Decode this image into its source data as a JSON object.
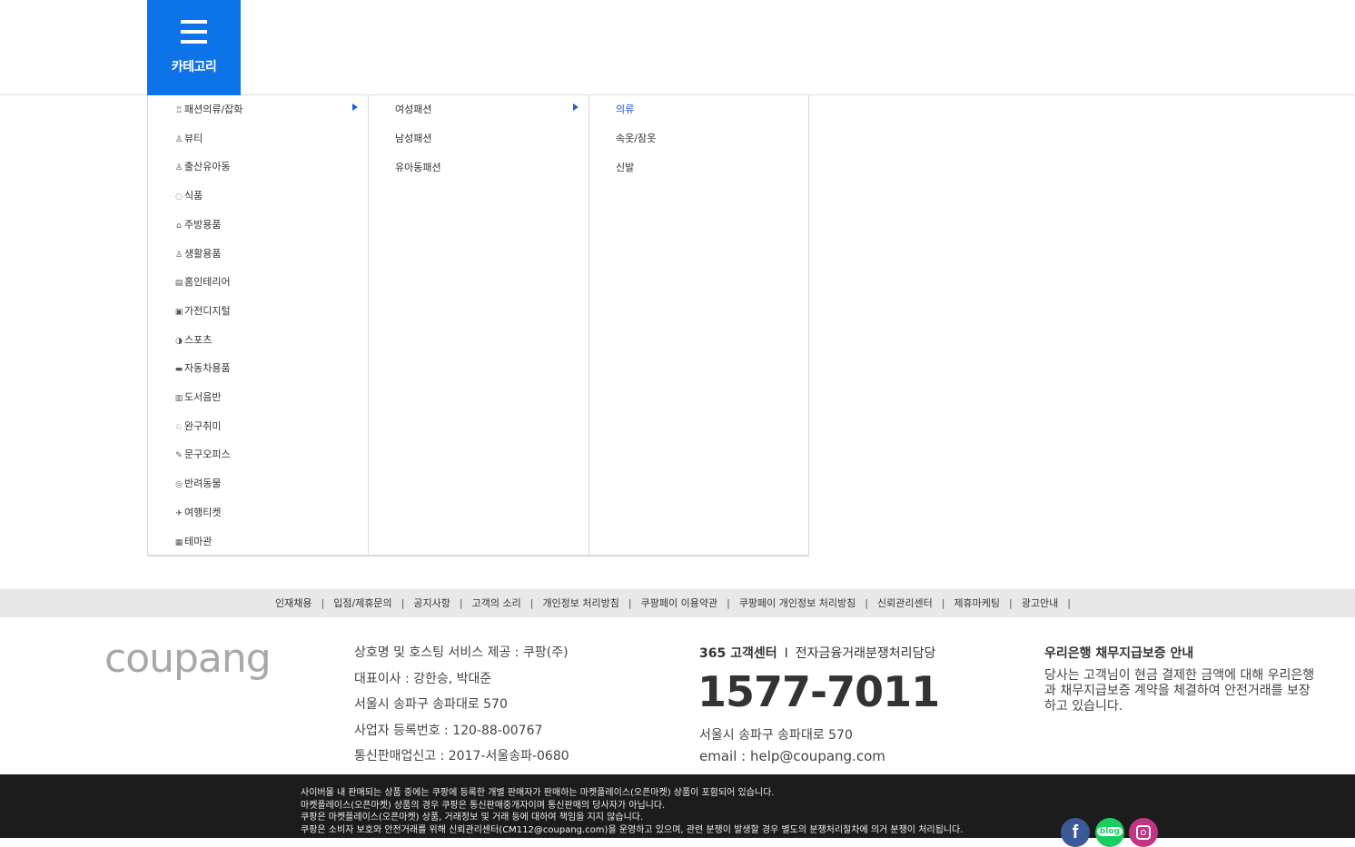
{
  "header": {
    "category_label": "카테고리",
    "accent_color": "#0d73e8"
  },
  "menu": {
    "level1": [
      {
        "label": "패션의류/잡화",
        "icon": "clothes-icon",
        "glyph": "♖"
      },
      {
        "label": "뷰티",
        "icon": "beauty-icon",
        "glyph": "♙"
      },
      {
        "label": "출산유아동",
        "icon": "baby-icon",
        "glyph": "♙"
      },
      {
        "label": "식품",
        "icon": "food-icon",
        "glyph": "◌"
      },
      {
        "label": "주방용품",
        "icon": "kitchen-icon",
        "glyph": "⌂"
      },
      {
        "label": "생활용품",
        "icon": "living-icon",
        "glyph": "♙"
      },
      {
        "label": "홈인테리어",
        "icon": "interior-icon",
        "glyph": "▤"
      },
      {
        "label": "가전디지털",
        "icon": "appliance-icon",
        "glyph": "▣"
      },
      {
        "label": "스포츠",
        "icon": "sports-icon",
        "glyph": "◑"
      },
      {
        "label": "자동차용품",
        "icon": "car-icon",
        "glyph": "▬"
      },
      {
        "label": "도서음반",
        "icon": "book-icon",
        "glyph": "▥"
      },
      {
        "label": "완구취미",
        "icon": "toy-icon",
        "glyph": "♘"
      },
      {
        "label": "문구오피스",
        "icon": "pen-icon",
        "glyph": "✎"
      },
      {
        "label": "반려동물",
        "icon": "pet-icon",
        "glyph": "◎"
      },
      {
        "label": "여행티켓",
        "icon": "travel-icon",
        "glyph": "✈"
      },
      {
        "label": "테마관",
        "icon": "theme-icon",
        "glyph": "▦"
      }
    ],
    "level2": [
      "여성패션",
      "남성패션",
      "유아동패션"
    ],
    "level3": [
      "의류",
      "속옷/잠옷",
      "신발"
    ]
  },
  "footer_links": [
    "인재채용",
    "입점/제휴문의",
    "공지사항",
    "고객의 소리",
    "개인정보 처리방침",
    "쿠팡페이 이용약관",
    "쿠팡페이 개인정보 처리방침",
    "신뢰관리센터",
    "제휴마케팅",
    "광고안내"
  ],
  "footer_sep": "|",
  "company": {
    "logo": "coupang",
    "lines": [
      "상호명 및 호스팅 서비스 제공 : 쿠팡(주)",
      "대표이사 : 강한승, 박대준",
      "서울시 송파구 송파대로 570",
      "사업자 등록번호 : 120-88-00767",
      "통신판매업신고 : 2017-서울송파-0680"
    ]
  },
  "customer_center": {
    "title": "365 고객센터",
    "bar": "I",
    "subtitle": "전자금융거래분쟁처리담당",
    "phone": "1577-7011",
    "address": "서울시 송파구 송파대로 570",
    "email": "email : help@coupang.com"
  },
  "bank": {
    "title": "우리은행 채무지급보증 안내",
    "desc": "당사는 고객님이 현금 결제한 금액에 대해 우리은행과 채무지급보증 계약을 체결하여 안전거래를 보장하고 있습니다."
  },
  "legal": [
    "사이버몰 내 판매되는 상품 중에는 쿠팡에 등록한 개별 판매자가 판매하는 마켓플레이스(오픈마켓) 상품이 포함되어 있습니다.",
    "마켓플레이스(오픈마켓) 상품의 경우 쿠팡은 통신판매중개자이며 통신판매의 당사자가 아닙니다.",
    "쿠팡은 마켓플레이스(오픈마켓) 상품, 거래정보 및 거래 등에 대하여 책임을 지지 않습니다.",
    "쿠팡은 소비자 보호와 안전거래를 위해 신뢰관리센터(CM112@coupang.com)을 운영하고 있으며, 관련 분쟁이 발생할 경우 별도의 분쟁처리절차에 의거 분쟁이 처리됩니다."
  ],
  "social": {
    "facebook": "f",
    "blog": "blog"
  }
}
